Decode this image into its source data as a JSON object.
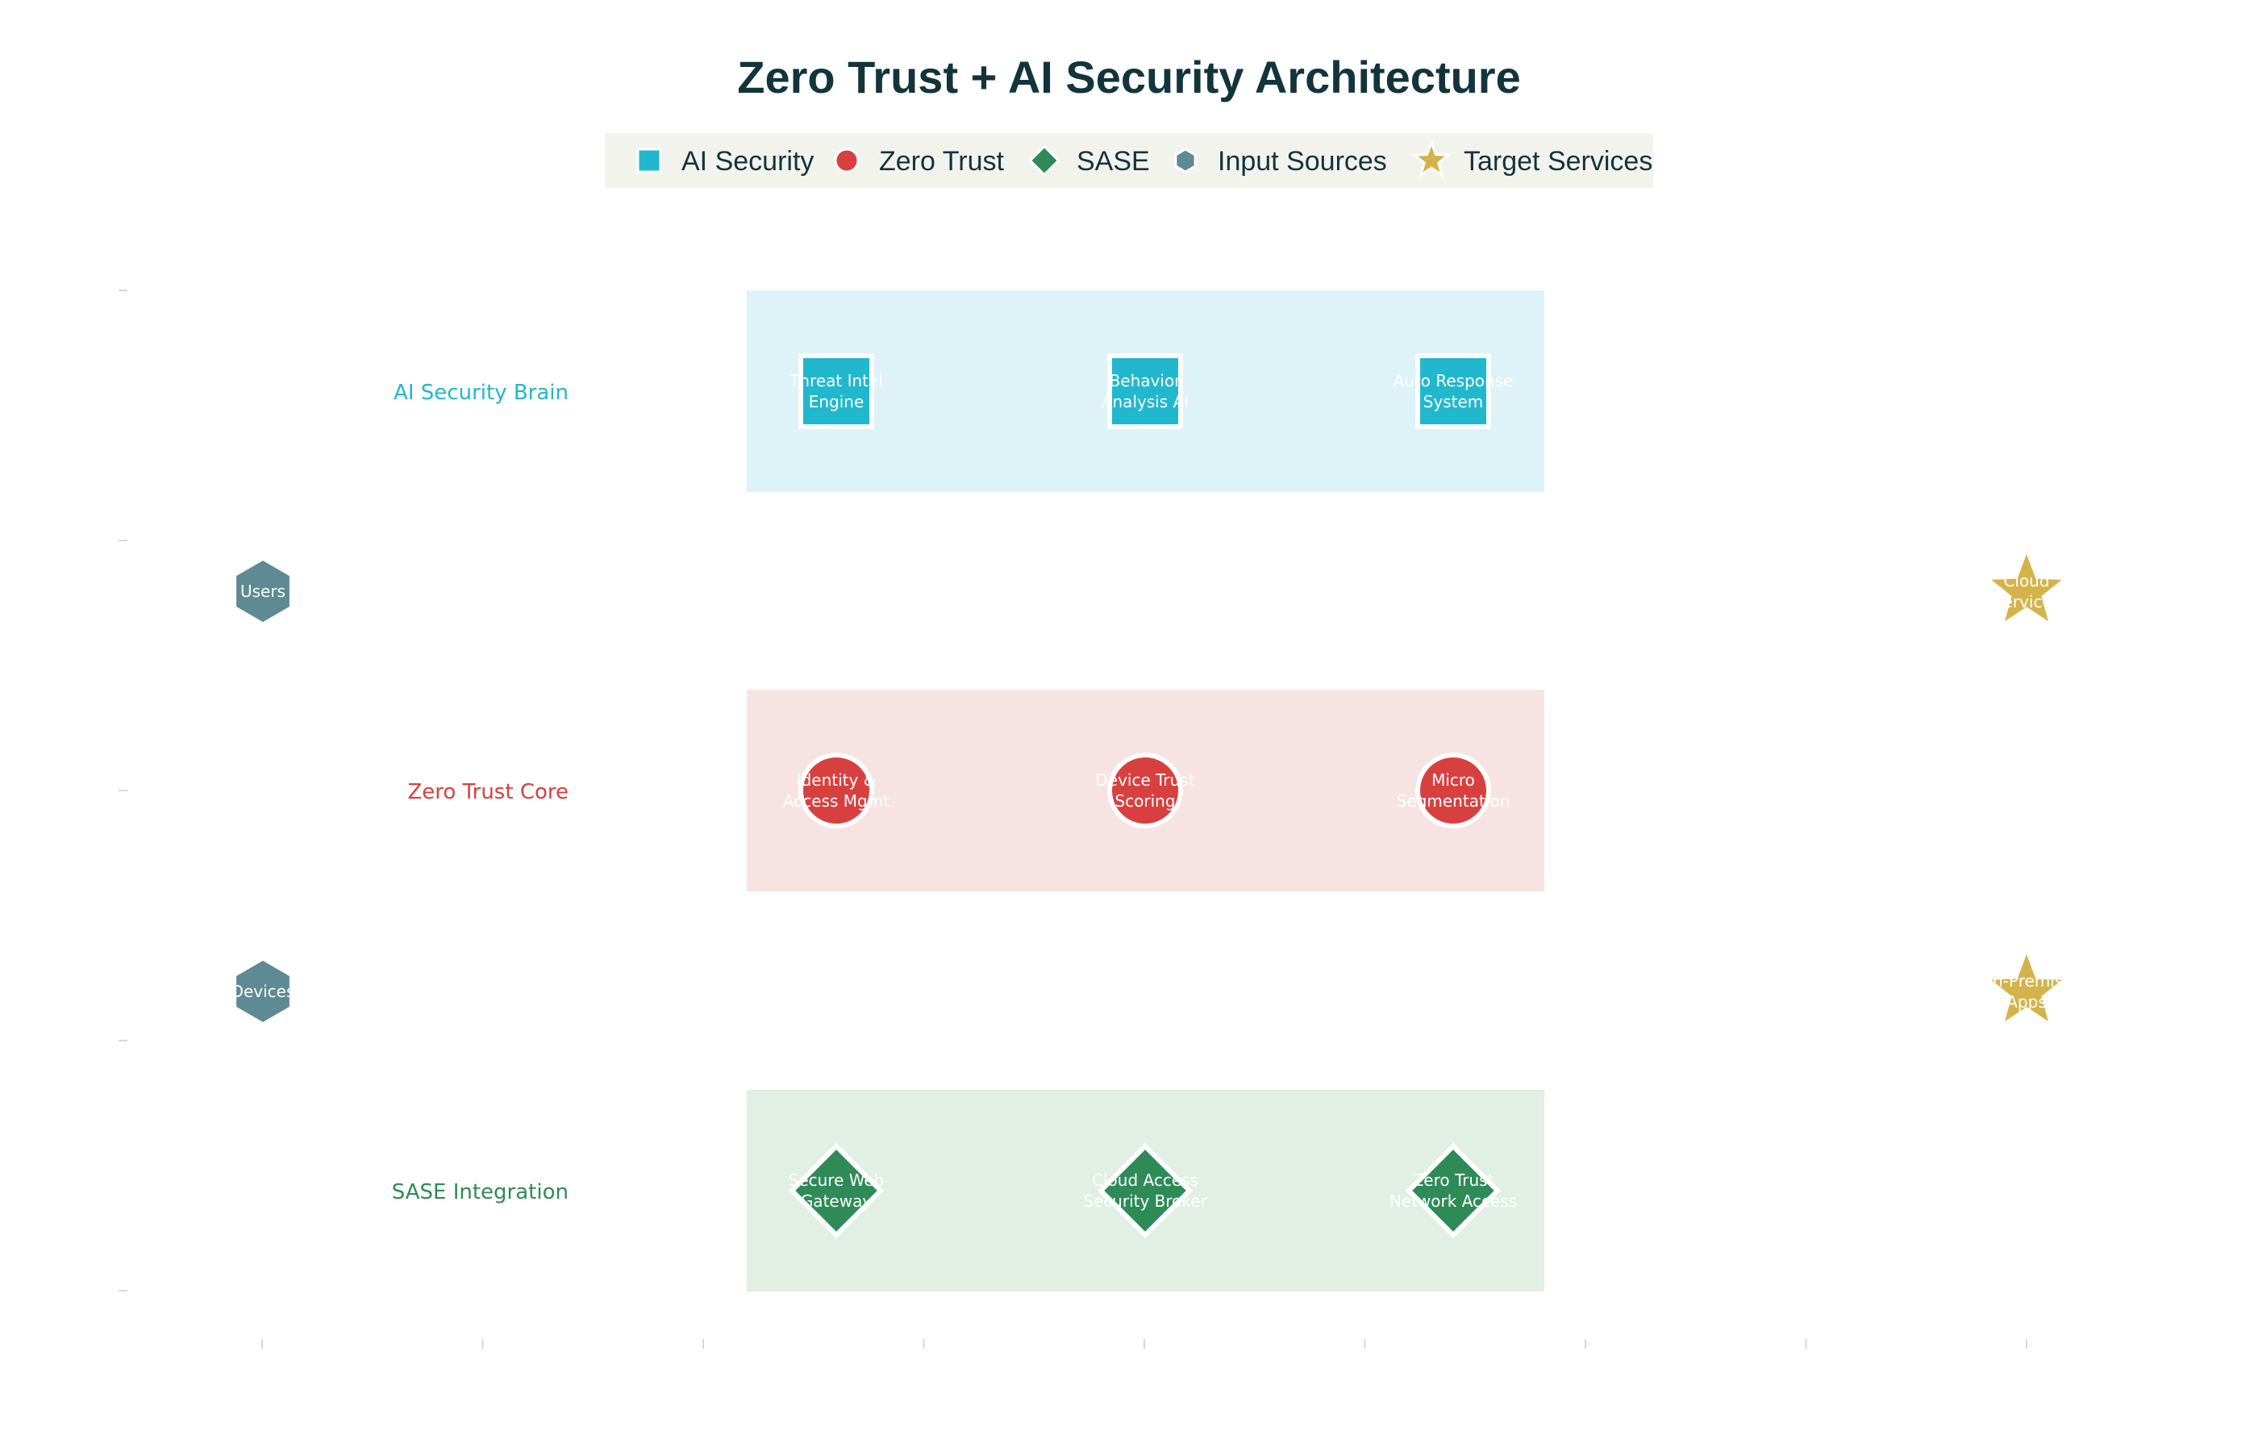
{
  "title": "Zero Trust + AI Security Architecture",
  "colors": {
    "ai": "#21b8cd",
    "zero_trust": "#d84040",
    "sase": "#2e8b57",
    "input": "#5e8a94",
    "target": "#d4b44a",
    "title": "#13343b",
    "legend_bg": "#f3f3ee",
    "ai_bg": "#ddf3f7",
    "zt_bg": "#f8e3e3",
    "sase_bg": "#e1efe5"
  },
  "legend": [
    {
      "label": "AI Security",
      "shape": "square",
      "color": "#21b8cd"
    },
    {
      "label": "Zero Trust",
      "shape": "circle",
      "color": "#d84040"
    },
    {
      "label": "SASE",
      "shape": "diamond",
      "color": "#2e8b57"
    },
    {
      "label": "Input Sources",
      "shape": "hexagon",
      "color": "#5e8a94"
    },
    {
      "label": "Target Services",
      "shape": "star",
      "color": "#d4b44a"
    }
  ],
  "layers": [
    {
      "label": "AI Security Brain",
      "shape": "square",
      "color": "#21b8cd",
      "bg": "#ddf3f7",
      "nodes": [
        [
          "Threat Intel",
          "Engine"
        ],
        [
          "Behavior",
          "Analysis AI"
        ],
        [
          "Auto Response",
          "System"
        ]
      ]
    },
    {
      "label": "Zero Trust Core",
      "shape": "circle",
      "color": "#d84040",
      "bg": "#f8e3e3",
      "nodes": [
        [
          "Identity &",
          "Access Mgmt"
        ],
        [
          "Device Trust",
          "Scoring"
        ],
        [
          "Micro",
          "Segmentation"
        ]
      ]
    },
    {
      "label": "SASE Integration",
      "shape": "diamond",
      "color": "#2e8b57",
      "bg": "#e1efe5",
      "nodes": [
        [
          "Secure Web",
          "Gateway"
        ],
        [
          "Cloud Access",
          "Security Broker"
        ],
        [
          "Zero Trust",
          "Network Access"
        ]
      ]
    }
  ],
  "inputs": [
    [
      "Users"
    ],
    [
      "Devices"
    ]
  ],
  "targets": [
    [
      "Cloud",
      "Services"
    ],
    [
      "On-Premise",
      "Apps"
    ]
  ]
}
